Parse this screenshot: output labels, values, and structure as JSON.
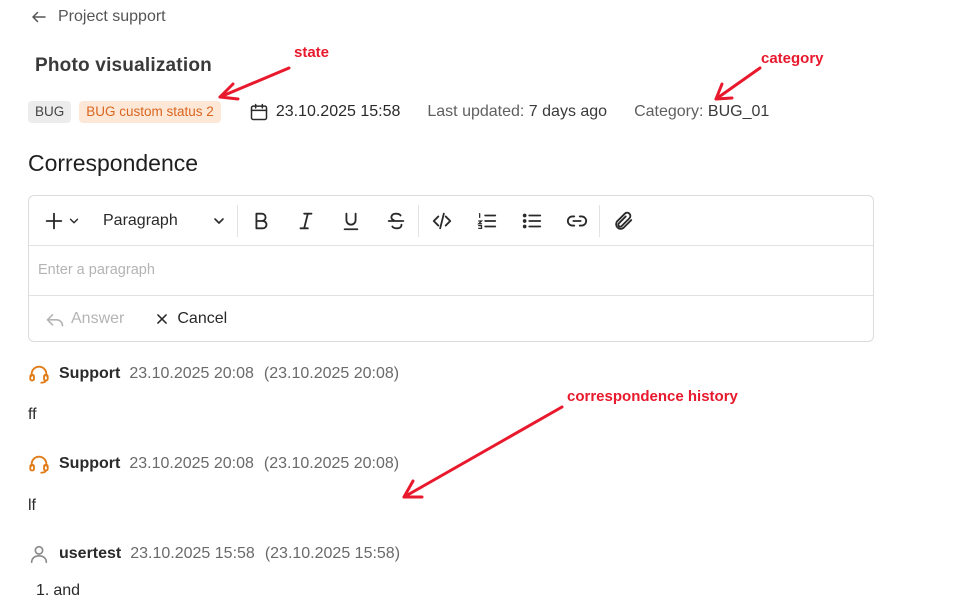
{
  "header": {
    "back_label": "Project support"
  },
  "ticket": {
    "title": "Photo visualization",
    "type_badge": "BUG",
    "status_badge": "BUG custom status 2",
    "created": "23.10.2025 15:58",
    "updated_label": "Last updated:",
    "updated_value": "7 days ago",
    "category_label": "Category:",
    "category_value": "BUG_01"
  },
  "correspondence": {
    "title": "Correspondence",
    "editor": {
      "block_type": "Paragraph",
      "placeholder": "Enter a paragraph",
      "answer_label": "Answer",
      "cancel_label": "Cancel"
    },
    "messages": [
      {
        "author": "Support",
        "role": "support",
        "created": "23.10.2025 20:08",
        "updated": "(23.10.2025 20:08)",
        "text": "ff"
      },
      {
        "author": "Support",
        "role": "support",
        "created": "23.10.2025 20:08",
        "updated": "(23.10.2025 20:08)",
        "text": "lf"
      },
      {
        "author": "usertest",
        "role": "user",
        "created": "23.10.2025 15:58",
        "updated": "(23.10.2025 15:58)",
        "list": [
          {
            "num": "1.",
            "text": "and"
          }
        ]
      }
    ]
  },
  "annotations": {
    "state": "state",
    "category": "category",
    "history": "correspondence history"
  },
  "colors": {
    "status_bg": "#fde8d8",
    "status_text": "#d9651e",
    "support_icon": "#e07b16",
    "annotation": "#e8192c"
  },
  "icons": [
    "arrow-left-icon",
    "calendar-icon",
    "plus-icon",
    "chevron-down-icon",
    "bold-icon",
    "italic-icon",
    "underline-icon",
    "strikethrough-icon",
    "code-icon",
    "ordered-list-icon",
    "bullet-list-icon",
    "link-icon",
    "paperclip-icon",
    "reply-icon",
    "close-icon",
    "headset-icon",
    "user-icon"
  ]
}
